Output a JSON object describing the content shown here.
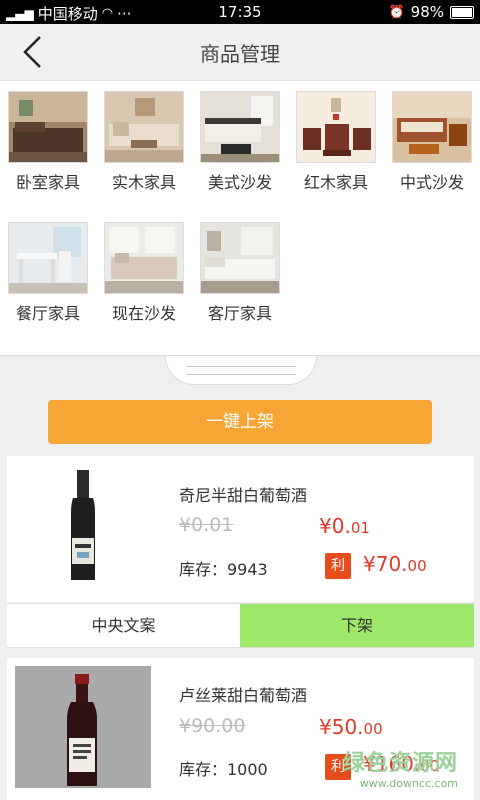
{
  "status_bar": {
    "carrier": "中国移动",
    "time": "17:35",
    "battery": "98%"
  },
  "header": {
    "title": "商品管理"
  },
  "categories": [
    {
      "label": "卧室家具"
    },
    {
      "label": "实木家具"
    },
    {
      "label": "美式沙发"
    },
    {
      "label": "红木家具"
    },
    {
      "label": "中式沙发"
    },
    {
      "label": "餐厅家具"
    },
    {
      "label": "现在沙发"
    },
    {
      "label": "客厅家具"
    }
  ],
  "actions": {
    "shelf_all": "一键上架"
  },
  "products": [
    {
      "name": "奇尼半甜白葡萄酒",
      "original_price": "¥0.01",
      "price_main": "¥0.",
      "price_dec": "01",
      "stock": "库存：9943",
      "profit_badge": "利",
      "profit_main": "¥70.",
      "profit_dec": "00",
      "action_copy": "中央文案",
      "action_unshelf": "下架"
    },
    {
      "name": "卢丝莱甜白葡萄酒",
      "original_price": "¥90.00",
      "price_main": "¥50.",
      "price_dec": "00",
      "stock": "库存：1000",
      "profit_badge": "利",
      "profit_main": "¥160.",
      "profit_dec": "00"
    }
  ],
  "watermark": {
    "line1": "绿色资源网",
    "line2": "www.downcc.com"
  }
}
